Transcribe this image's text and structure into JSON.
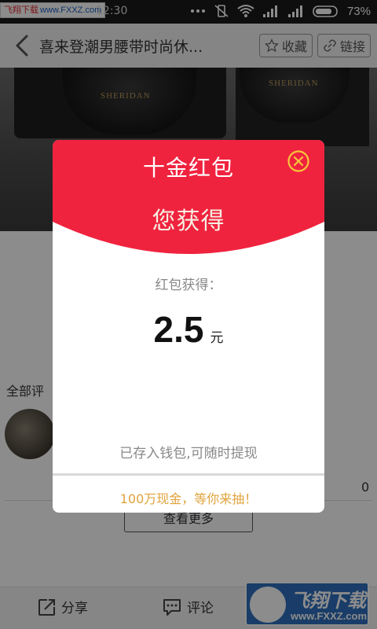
{
  "status_bar": {
    "watermark": "飞翔下载",
    "watermark_domain": "www.FXXZ.com",
    "time": "12:30",
    "battery": "73%"
  },
  "header": {
    "title": "喜来登潮男腰带时尚休...",
    "favorite_label": "收藏",
    "link_label": "链接"
  },
  "product": {
    "brand": "SHERIDAN"
  },
  "comments": {
    "section_title": "全部评",
    "count": "0",
    "more_label": "查看更多"
  },
  "bottom_bar": {
    "share_label": "分享",
    "comment_label": "评论"
  },
  "watermark_logo": {
    "cn": "飞翔下载",
    "en": "www.FXXZ.com"
  },
  "modal": {
    "title": "十金红包",
    "subtitle": "您获得",
    "got_label": "红包获得：",
    "amount": "2.5",
    "unit": "元",
    "saved_text": "已存入钱包,可随时提现",
    "promo": "100万现金，等你来抽！"
  },
  "colors": {
    "red": "#f0233f",
    "gold": "#e0a33c",
    "close_ring": "#f7c53a"
  }
}
